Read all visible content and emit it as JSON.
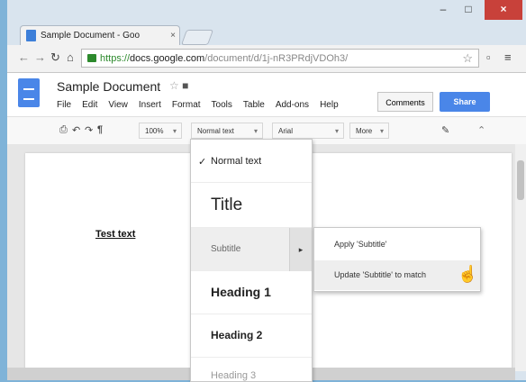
{
  "browser": {
    "tab_title": "Sample Document - Goo",
    "tab_close": "×",
    "url_scheme": "https://",
    "url_host": "docs.google.com",
    "url_path": "/document/d/1j-nR3PRdjVDOh3/",
    "win_min": "–",
    "win_max": "□",
    "win_close": "×"
  },
  "docs": {
    "title": "Sample Document",
    "menu": [
      "File",
      "Edit",
      "View",
      "Insert",
      "Format",
      "Tools",
      "Table",
      "Add-ons",
      "Help"
    ],
    "comments_label": "Comments",
    "share_label": "Share"
  },
  "toolbar": {
    "zoom": "100%",
    "style": "Normal text",
    "font": "Arial",
    "more": "More"
  },
  "document": {
    "body_text": "Test text"
  },
  "style_menu": {
    "normal": "Normal text",
    "check": "✓",
    "title": "Title",
    "subtitle": "Subtitle",
    "submenu_arrow": "▸",
    "heading1": "Heading 1",
    "heading2": "Heading 2",
    "heading3": "Heading 3"
  },
  "submenu": {
    "apply": "Apply 'Subtitle'",
    "update": "Update 'Subtitle' to match"
  },
  "icons": [
    "docs-logo-icon",
    "star-icon",
    "folder-icon",
    "print-icon",
    "undo-icon",
    "redo-icon",
    "paint-format-icon",
    "pen-icon",
    "collapse-icon",
    "back-icon",
    "forward-icon",
    "reload-icon",
    "home-icon",
    "lock-icon",
    "menu-icon",
    "hand-cursor-icon"
  ],
  "colors": {
    "accent": "#4a86e8",
    "close": "#c8413a",
    "secure": "#2d8a2d"
  }
}
